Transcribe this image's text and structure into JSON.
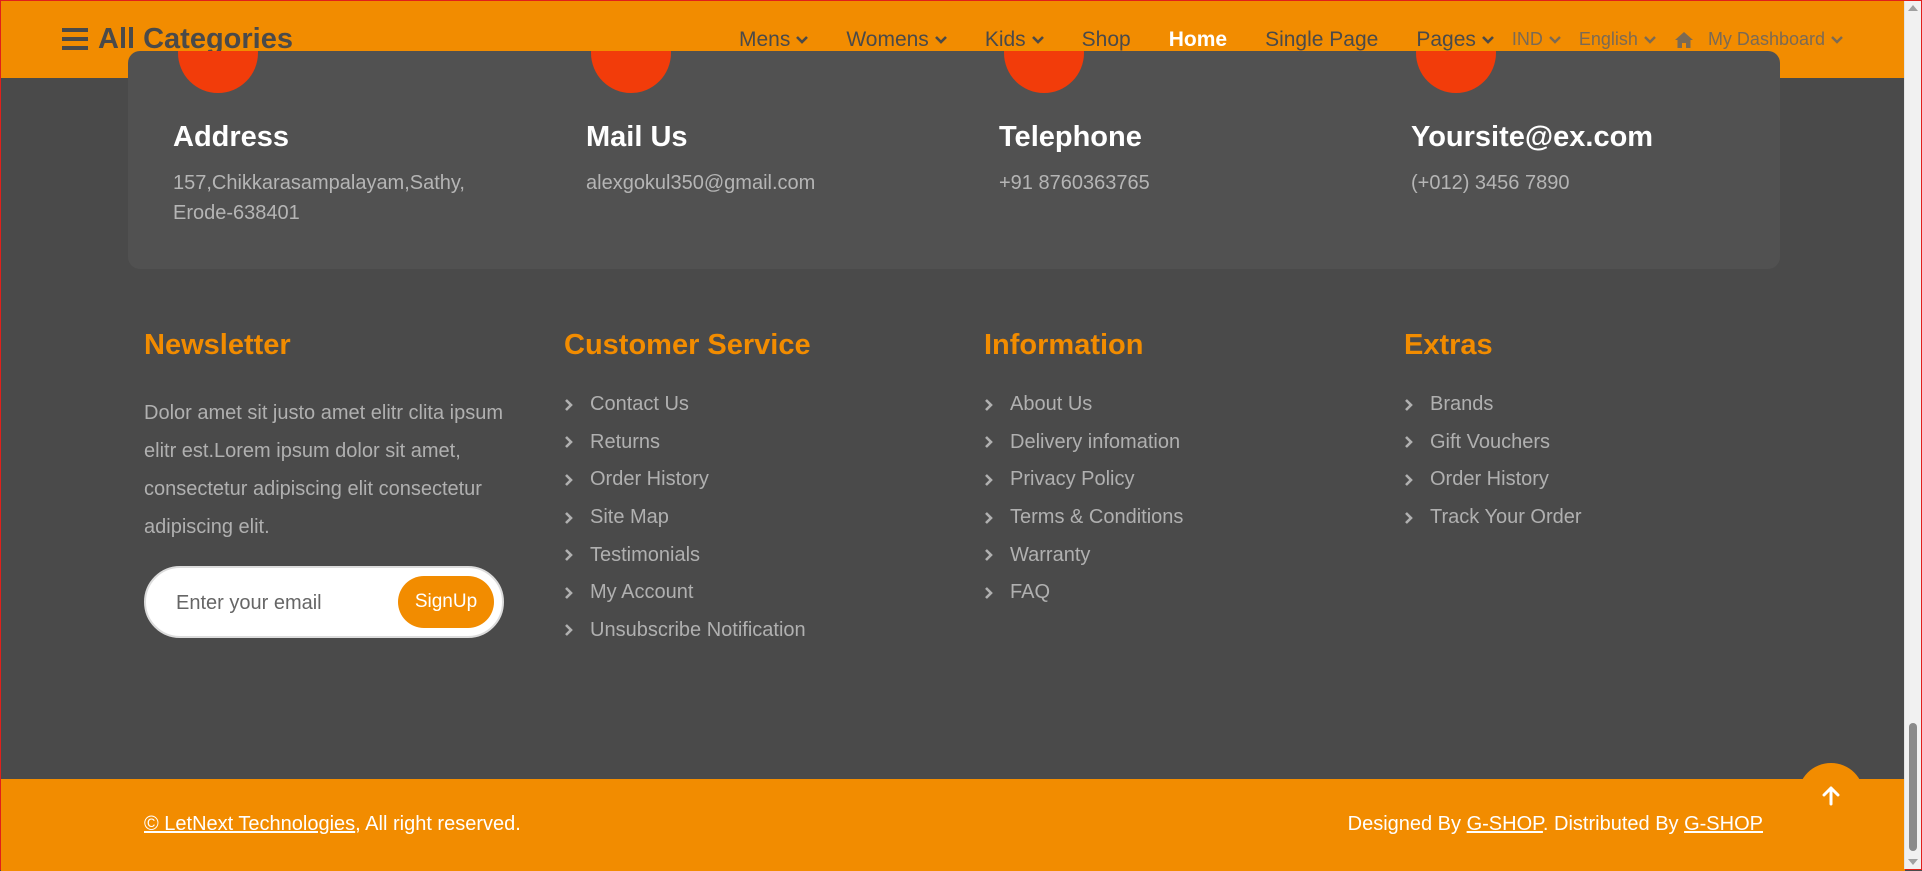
{
  "header": {
    "brand": "All Categories",
    "nav": [
      {
        "label": "Mens",
        "dropdown": true
      },
      {
        "label": "Womens",
        "dropdown": true
      },
      {
        "label": "Kids",
        "dropdown": true
      },
      {
        "label": "Shop",
        "dropdown": false
      },
      {
        "label": "Home",
        "dropdown": false,
        "active": true
      },
      {
        "label": "Single Page",
        "dropdown": false
      },
      {
        "label": "Pages",
        "dropdown": true
      }
    ],
    "currency": "IND",
    "language": "English",
    "dashboard": "My Dashboard",
    "icons": [
      "bars-icon",
      "chevron-down-icon",
      "home-icon"
    ]
  },
  "contact": [
    {
      "title": "Address",
      "lines": [
        "157,Chikkarasampalayam,Sathy,",
        "Erode-638401"
      ]
    },
    {
      "title": "Mail Us",
      "lines": [
        "alexgokul350@gmail.com"
      ]
    },
    {
      "title": "Telephone",
      "lines": [
        "+91 8760363765"
      ]
    },
    {
      "title": "Yoursite@ex.com",
      "lines": [
        "(+012) 3456 7890"
      ]
    }
  ],
  "newsletter": {
    "title": "Newsletter",
    "text": "Dolor amet sit justo amet elitr clita ipsum elitr est.Lorem ipsum dolor sit amet, consectetur adipiscing elit consectetur adipiscing elit.",
    "placeholder": "Enter your email",
    "button": "SignUp"
  },
  "customer_service": {
    "title": "Customer Service",
    "items": [
      "Contact Us",
      "Returns",
      "Order History",
      "Site Map",
      "Testimonials",
      "My Account",
      "Unsubscribe Notification"
    ]
  },
  "information": {
    "title": "Information",
    "items": [
      "About Us",
      "Delivery infomation",
      "Privacy Policy",
      "Terms & Conditions",
      "Warranty",
      "FAQ"
    ]
  },
  "extras": {
    "title": "Extras",
    "items": [
      "Brands",
      "Gift Vouchers",
      "Order History",
      "Track Your Order"
    ]
  },
  "footer": {
    "copyright_link": "© LetNext Technologies",
    "copyright_rest": ", All right reserved.",
    "designed_by": "Designed By ",
    "designer": "G-SHOP",
    "distributed_by": ". Distributed By ",
    "distributor": "G-SHOP"
  },
  "colors": {
    "accent": "#f28c00",
    "background": "#4a4a4a",
    "panel": "#515151",
    "circle": "#f23c0a"
  }
}
